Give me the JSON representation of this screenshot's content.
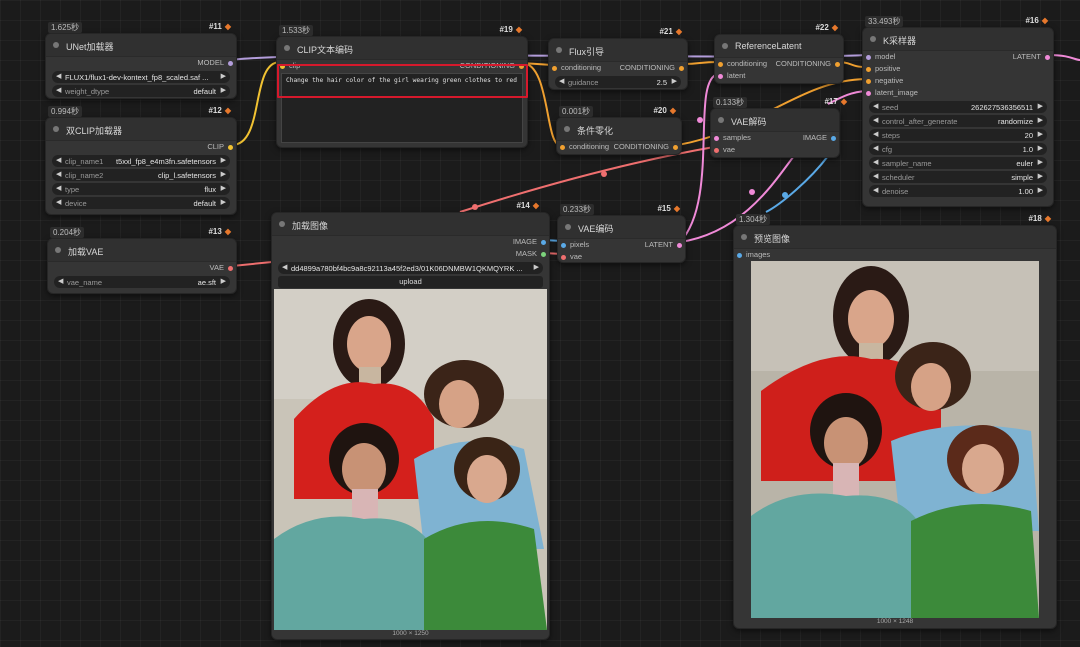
{
  "colors": {
    "model": "#b39ddb",
    "clip": "#f1c232",
    "conditioning": "#f0a030",
    "vae": "#ef6f6f",
    "latent": "#f08ad8",
    "image": "#5aa9e6",
    "mask": "#7cd37c",
    "highlight": "#d6192c"
  },
  "badge_icon": "fox-icon",
  "nodes": {
    "unet_loader": {
      "timing": "1.625秒",
      "id": "#11",
      "title": "UNet加载器",
      "out_model": "MODEL",
      "unet_name": "FLUX1/flux1-dev-kontext_fp8_scaled.saf ...",
      "weight_dtype_name": "weight_dtype",
      "weight_dtype_value": "default"
    },
    "dual_clip_loader": {
      "timing": "0.994秒",
      "id": "#12",
      "title": "双CLIP加载器",
      "out_clip": "CLIP",
      "clip_name1_name": "clip_name1",
      "clip_name1_value": "t5xxl_fp8_e4m3fn.safetensors",
      "clip_name2_name": "clip_name2",
      "clip_name2_value": "clip_l.safetensors",
      "type_name": "type",
      "type_value": "flux",
      "device_name": "device",
      "device_value": "default"
    },
    "vae_loader": {
      "timing": "0.204秒",
      "id": "#13",
      "title": "加载VAE",
      "out_vae": "VAE",
      "vae_name_name": "vae_name",
      "vae_name_value": "ae.sft"
    },
    "clip_text_encode": {
      "timing": "1.533秒",
      "id": "#19",
      "title": "CLIP文本编码",
      "in_clip": "clip",
      "out_conditioning": "CONDITIONING",
      "prompt": "Change the hair color of the girl wearing green clothes to red"
    },
    "flux_guidance": {
      "id": "#21",
      "title": "Flux引导",
      "in_conditioning": "conditioning",
      "out_conditioning": "CONDITIONING",
      "guidance_name": "guidance",
      "guidance_value": "2.5"
    },
    "conditioning_zero": {
      "timing": "0.001秒",
      "id": "#20",
      "title": "条件零化",
      "in_conditioning": "conditioning",
      "out_conditioning": "CONDITIONING"
    },
    "reference_latent": {
      "id": "#22",
      "title": "ReferenceLatent",
      "in_conditioning": "conditioning",
      "in_latent": "latent",
      "out_conditioning": "CONDITIONING"
    },
    "vae_decode": {
      "timing": "0.133秒",
      "id": "#17",
      "title": "VAE解码",
      "in_samples": "samples",
      "in_vae": "vae",
      "out_image": "IMAGE"
    },
    "ksampler": {
      "timing": "33.493秒",
      "id": "#16",
      "title": "K采样器",
      "in_model": "model",
      "in_positive": "positive",
      "in_negative": "negative",
      "in_latent": "latent_image",
      "out_latent": "LATENT",
      "seed_name": "seed",
      "seed_value": "262627536356511",
      "control_name": "control_after_generate",
      "control_value": "randomize",
      "steps_name": "steps",
      "steps_value": "20",
      "cfg_name": "cfg",
      "cfg_value": "1.0",
      "sampler_name": "sampler_name",
      "sampler_value": "euler",
      "scheduler_name": "scheduler",
      "scheduler_value": "simple",
      "denoise_name": "denoise",
      "denoise_value": "1.00"
    },
    "load_image": {
      "id": "#14",
      "title": "加载图像",
      "out_image": "IMAGE",
      "out_mask": "MASK",
      "image_value": "dd4899a780bf4bc9a8c92113a45f2ed3/01K06DNMBW1QKMQYRK ...",
      "upload_label": "upload",
      "image_size": "1000 × 1250"
    },
    "vae_encode": {
      "timing": "0.233秒",
      "id": "#15",
      "title": "VAE编码",
      "in_pixels": "pixels",
      "in_vae": "vae",
      "out_latent": "LATENT"
    },
    "preview_image": {
      "timing": "1.304秒",
      "id": "#18",
      "title": "预览图像",
      "in_images": "images",
      "image_size": "1000 × 1248"
    }
  }
}
